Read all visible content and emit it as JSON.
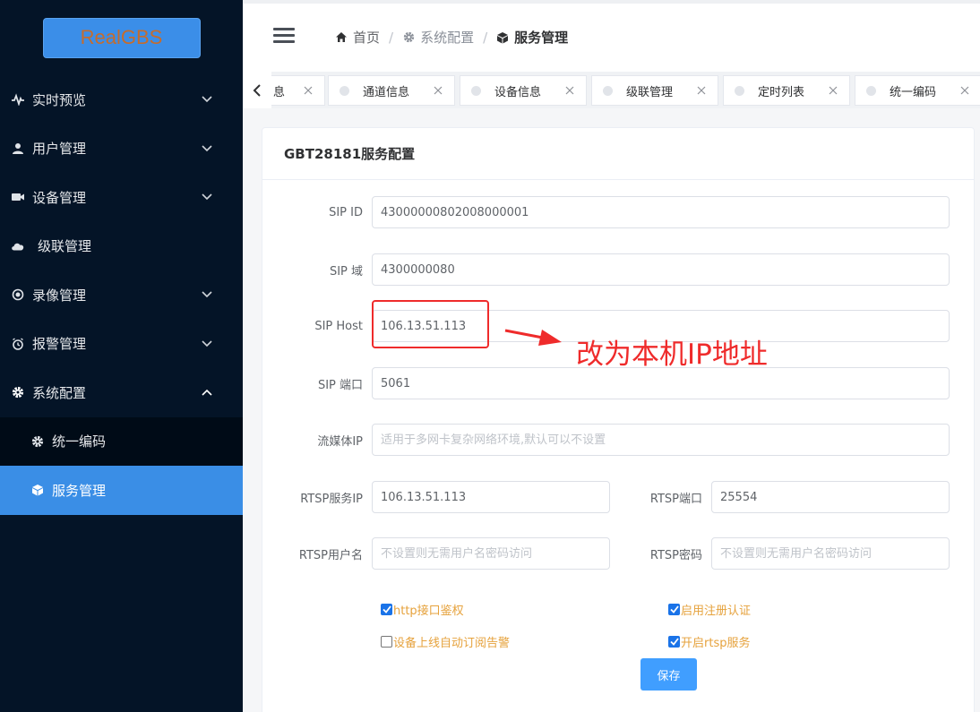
{
  "brand": {
    "logo_text": "RealGBS"
  },
  "sidebar": {
    "items": [
      {
        "label": "实时预览",
        "icon": "pulse-icon",
        "chevron": "down"
      },
      {
        "label": "用户管理",
        "icon": "user-icon",
        "chevron": "down"
      },
      {
        "label": "设备管理",
        "icon": "video-camera-icon",
        "chevron": "down"
      },
      {
        "label": "级联管理",
        "icon": "cloud-icon",
        "chevron": ""
      },
      {
        "label": "录像管理",
        "icon": "record-icon",
        "chevron": "down"
      },
      {
        "label": "报警管理",
        "icon": "alarm-clock-icon",
        "chevron": "down"
      },
      {
        "label": "系统配置",
        "icon": "gear-icon",
        "chevron": "up"
      }
    ],
    "subitems": [
      {
        "label": "统一编码",
        "icon": "gear-icon"
      },
      {
        "label": "服务管理",
        "icon": "cube-icon",
        "active": true
      }
    ]
  },
  "header": {
    "breadcrumbs": [
      {
        "label": "首页",
        "icon": "home-icon"
      },
      {
        "label": "系统配置",
        "icon": "gear-icon"
      },
      {
        "label": "服务管理",
        "icon": "cube-icon"
      }
    ],
    "separator": "/"
  },
  "tabs": [
    {
      "label": "息"
    },
    {
      "label": "通道信息"
    },
    {
      "label": "设备信息"
    },
    {
      "label": "级联管理"
    },
    {
      "label": "定时列表"
    },
    {
      "label": "统一编码"
    }
  ],
  "card": {
    "title": "GBT28181服务配置"
  },
  "form": {
    "sip_id": {
      "label": "SIP ID",
      "value": "43000000802008000001"
    },
    "sip_domain": {
      "label": "SIP 域",
      "value": "4300000080"
    },
    "sip_host": {
      "label": "SIP Host",
      "value": "106.13.51.113"
    },
    "sip_port": {
      "label": "SIP 端口",
      "value": "5061"
    },
    "media_ip": {
      "label": "流媒体IP",
      "value": "",
      "placeholder": "适用于多网卡复杂网络环境,默认可以不设置"
    },
    "rtsp_ip": {
      "label": "RTSP服务IP",
      "value": "106.13.51.113"
    },
    "rtsp_port": {
      "label": "RTSP端口",
      "value": "25554"
    },
    "rtsp_user": {
      "label": "RTSP用户名",
      "value": "",
      "placeholder": "不设置则无需用户名密码访问"
    },
    "rtsp_pass": {
      "label": "RTSP密码",
      "value": "",
      "placeholder": "不设置则无需用户名密码访问"
    }
  },
  "checkboxes": [
    {
      "label": "http接口鉴权",
      "checked": true
    },
    {
      "label": "启用注册认证",
      "checked": true
    },
    {
      "label": "设备上线自动订阅告警",
      "checked": false
    },
    {
      "label": "开启rtsp服务",
      "checked": true
    }
  ],
  "buttons": {
    "save": "保存"
  },
  "annotation": {
    "text": "改为本机IP地址",
    "color": "#ef2b2b"
  },
  "colors": {
    "sidebar_bg": "#041427",
    "active_item": "#3a8ee6",
    "primary": "#409eff",
    "checkbox_label": "#e6a23c"
  }
}
